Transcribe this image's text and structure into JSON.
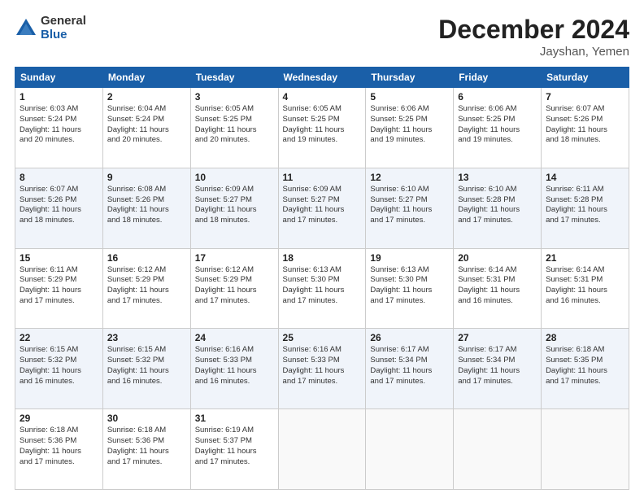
{
  "header": {
    "logo_general": "General",
    "logo_blue": "Blue",
    "title": "December 2024",
    "location": "Jayshan, Yemen"
  },
  "days_of_week": [
    "Sunday",
    "Monday",
    "Tuesday",
    "Wednesday",
    "Thursday",
    "Friday",
    "Saturday"
  ],
  "weeks": [
    [
      {
        "day": "1",
        "info": "Sunrise: 6:03 AM\nSunset: 5:24 PM\nDaylight: 11 hours\nand 20 minutes."
      },
      {
        "day": "2",
        "info": "Sunrise: 6:04 AM\nSunset: 5:24 PM\nDaylight: 11 hours\nand 20 minutes."
      },
      {
        "day": "3",
        "info": "Sunrise: 6:05 AM\nSunset: 5:25 PM\nDaylight: 11 hours\nand 20 minutes."
      },
      {
        "day": "4",
        "info": "Sunrise: 6:05 AM\nSunset: 5:25 PM\nDaylight: 11 hours\nand 19 minutes."
      },
      {
        "day": "5",
        "info": "Sunrise: 6:06 AM\nSunset: 5:25 PM\nDaylight: 11 hours\nand 19 minutes."
      },
      {
        "day": "6",
        "info": "Sunrise: 6:06 AM\nSunset: 5:25 PM\nDaylight: 11 hours\nand 19 minutes."
      },
      {
        "day": "7",
        "info": "Sunrise: 6:07 AM\nSunset: 5:26 PM\nDaylight: 11 hours\nand 18 minutes."
      }
    ],
    [
      {
        "day": "8",
        "info": "Sunrise: 6:07 AM\nSunset: 5:26 PM\nDaylight: 11 hours\nand 18 minutes."
      },
      {
        "day": "9",
        "info": "Sunrise: 6:08 AM\nSunset: 5:26 PM\nDaylight: 11 hours\nand 18 minutes."
      },
      {
        "day": "10",
        "info": "Sunrise: 6:09 AM\nSunset: 5:27 PM\nDaylight: 11 hours\nand 18 minutes."
      },
      {
        "day": "11",
        "info": "Sunrise: 6:09 AM\nSunset: 5:27 PM\nDaylight: 11 hours\nand 17 minutes."
      },
      {
        "day": "12",
        "info": "Sunrise: 6:10 AM\nSunset: 5:27 PM\nDaylight: 11 hours\nand 17 minutes."
      },
      {
        "day": "13",
        "info": "Sunrise: 6:10 AM\nSunset: 5:28 PM\nDaylight: 11 hours\nand 17 minutes."
      },
      {
        "day": "14",
        "info": "Sunrise: 6:11 AM\nSunset: 5:28 PM\nDaylight: 11 hours\nand 17 minutes."
      }
    ],
    [
      {
        "day": "15",
        "info": "Sunrise: 6:11 AM\nSunset: 5:29 PM\nDaylight: 11 hours\nand 17 minutes."
      },
      {
        "day": "16",
        "info": "Sunrise: 6:12 AM\nSunset: 5:29 PM\nDaylight: 11 hours\nand 17 minutes."
      },
      {
        "day": "17",
        "info": "Sunrise: 6:12 AM\nSunset: 5:29 PM\nDaylight: 11 hours\nand 17 minutes."
      },
      {
        "day": "18",
        "info": "Sunrise: 6:13 AM\nSunset: 5:30 PM\nDaylight: 11 hours\nand 17 minutes."
      },
      {
        "day": "19",
        "info": "Sunrise: 6:13 AM\nSunset: 5:30 PM\nDaylight: 11 hours\nand 17 minutes."
      },
      {
        "day": "20",
        "info": "Sunrise: 6:14 AM\nSunset: 5:31 PM\nDaylight: 11 hours\nand 16 minutes."
      },
      {
        "day": "21",
        "info": "Sunrise: 6:14 AM\nSunset: 5:31 PM\nDaylight: 11 hours\nand 16 minutes."
      }
    ],
    [
      {
        "day": "22",
        "info": "Sunrise: 6:15 AM\nSunset: 5:32 PM\nDaylight: 11 hours\nand 16 minutes."
      },
      {
        "day": "23",
        "info": "Sunrise: 6:15 AM\nSunset: 5:32 PM\nDaylight: 11 hours\nand 16 minutes."
      },
      {
        "day": "24",
        "info": "Sunrise: 6:16 AM\nSunset: 5:33 PM\nDaylight: 11 hours\nand 16 minutes."
      },
      {
        "day": "25",
        "info": "Sunrise: 6:16 AM\nSunset: 5:33 PM\nDaylight: 11 hours\nand 17 minutes."
      },
      {
        "day": "26",
        "info": "Sunrise: 6:17 AM\nSunset: 5:34 PM\nDaylight: 11 hours\nand 17 minutes."
      },
      {
        "day": "27",
        "info": "Sunrise: 6:17 AM\nSunset: 5:34 PM\nDaylight: 11 hours\nand 17 minutes."
      },
      {
        "day": "28",
        "info": "Sunrise: 6:18 AM\nSunset: 5:35 PM\nDaylight: 11 hours\nand 17 minutes."
      }
    ],
    [
      {
        "day": "29",
        "info": "Sunrise: 6:18 AM\nSunset: 5:36 PM\nDaylight: 11 hours\nand 17 minutes."
      },
      {
        "day": "30",
        "info": "Sunrise: 6:18 AM\nSunset: 5:36 PM\nDaylight: 11 hours\nand 17 minutes."
      },
      {
        "day": "31",
        "info": "Sunrise: 6:19 AM\nSunset: 5:37 PM\nDaylight: 11 hours\nand 17 minutes."
      },
      null,
      null,
      null,
      null
    ]
  ]
}
